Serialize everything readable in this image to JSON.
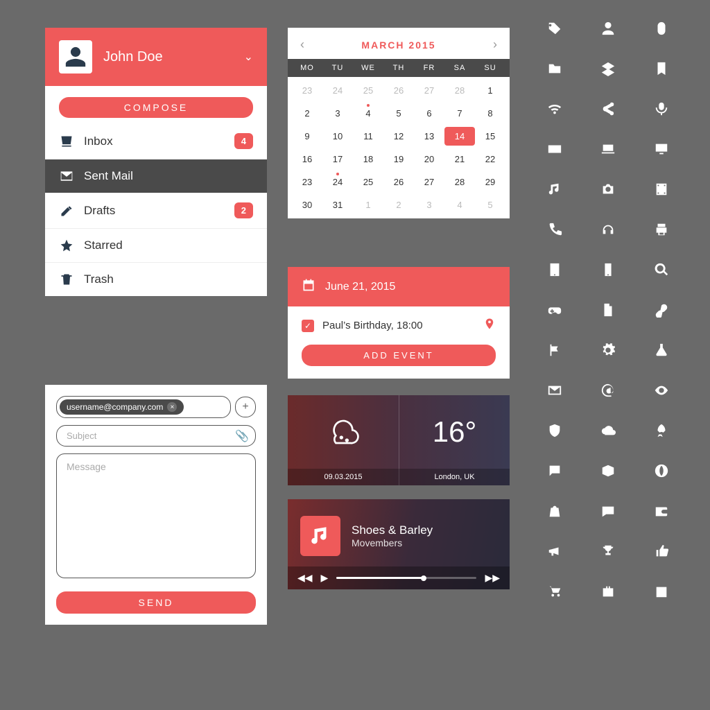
{
  "colors": {
    "accent": "#ef5a5a",
    "dark": "#4a4a4a"
  },
  "email": {
    "user_name": "John Doe",
    "compose_label": "COMPOSE",
    "folders": [
      {
        "icon": "inbox-icon",
        "label": "Inbox",
        "badge": "4",
        "active": false
      },
      {
        "icon": "envelope-icon",
        "label": "Sent Mail",
        "badge": null,
        "active": true
      },
      {
        "icon": "pencil-icon",
        "label": "Drafts",
        "badge": "2",
        "active": false
      },
      {
        "icon": "star-icon",
        "label": "Starred",
        "badge": null,
        "active": false
      },
      {
        "icon": "trash-icon",
        "label": "Trash",
        "badge": null,
        "active": false
      }
    ]
  },
  "compose": {
    "recipient_chip": "username@company.com",
    "subject_placeholder": "Subject",
    "message_placeholder": "Message",
    "send_label": "SEND"
  },
  "calendar": {
    "title": "MARCH 2015",
    "dow": [
      "MO",
      "TU",
      "WE",
      "TH",
      "FR",
      "SA",
      "SU"
    ],
    "selected": 14,
    "dots": [
      4,
      24
    ],
    "leading_muted": [
      23,
      24,
      25,
      26,
      27,
      28
    ],
    "days": [
      1,
      2,
      3,
      4,
      5,
      6,
      7,
      8,
      9,
      10,
      11,
      12,
      13,
      14,
      15,
      16,
      17,
      18,
      19,
      20,
      21,
      22,
      23,
      24,
      25,
      26,
      27,
      28,
      29,
      30,
      31
    ],
    "trailing_muted": [
      1,
      2,
      3,
      4,
      5
    ]
  },
  "event": {
    "date": "June 21, 2015",
    "item_text": "Paul’s Birthday, 18:00",
    "add_label": "ADD EVENT"
  },
  "weather": {
    "temp": "16°",
    "date": "09.03.2015",
    "location": "London, UK"
  },
  "player": {
    "track": "Shoes & Barley",
    "artist": "Movembers",
    "progress_pct": 62
  },
  "icon_grid": [
    "tag-icon",
    "user-icon",
    "mouse-icon",
    "folder-icon",
    "layers-icon",
    "bookmark-icon",
    "wifi-icon",
    "share-icon",
    "mic-icon",
    "keyboard-icon",
    "laptop-icon",
    "monitor-icon",
    "music-note-icon",
    "camera-icon",
    "film-icon",
    "phone-icon",
    "headphones-icon",
    "printer-icon",
    "tablet-icon",
    "smartphone-icon",
    "search-icon",
    "gamepad-icon",
    "document-icon",
    "link-icon",
    "flag-icon",
    "gear-icon",
    "flask-icon",
    "envelope-icon",
    "at-icon",
    "eye-icon",
    "shield-icon",
    "cloud-icon",
    "rocket-icon",
    "chat-icon",
    "box-icon",
    "globe-icon",
    "bag-icon",
    "message-icon",
    "wallet-icon",
    "megaphone-icon",
    "trophy-icon",
    "thumbs-up-icon",
    "cart-icon",
    "briefcase-icon",
    "calendar-icon"
  ]
}
